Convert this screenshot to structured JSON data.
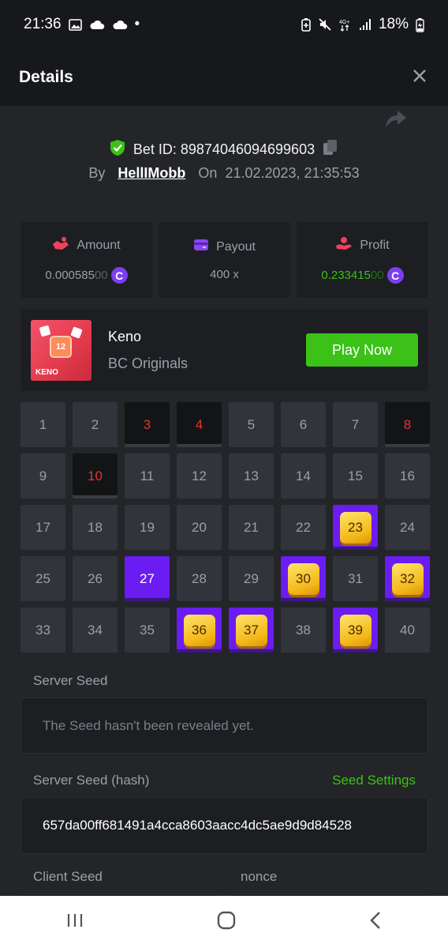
{
  "status_bar": {
    "time": "21:36",
    "dot": "•",
    "battery": "18%"
  },
  "header": {
    "title": "Details"
  },
  "bet": {
    "id_label": "Bet ID: 89874046094699603",
    "by_label": "By",
    "user": "HellIMobb",
    "on_label": "On",
    "datetime": "21.02.2023, 21:35:53"
  },
  "stats": {
    "amount": {
      "label": "Amount",
      "value_main": "0.000585",
      "value_dim": "00"
    },
    "payout": {
      "label": "Payout",
      "value": "400 x"
    },
    "profit": {
      "label": "Profit",
      "value_main": "0.233415",
      "value_dim": "00"
    }
  },
  "coin_symbol": "C",
  "game": {
    "name": "Keno",
    "provider": "BC Originals",
    "play_label": "Play Now",
    "thumb_number": "12",
    "thumb_label": "KENO"
  },
  "keno": {
    "numbers": [
      "1",
      "2",
      "3",
      "4",
      "5",
      "6",
      "7",
      "8",
      "9",
      "10",
      "11",
      "12",
      "13",
      "14",
      "15",
      "16",
      "17",
      "18",
      "19",
      "20",
      "21",
      "22",
      "23",
      "24",
      "25",
      "26",
      "27",
      "28",
      "29",
      "30",
      "31",
      "32",
      "33",
      "34",
      "35",
      "36",
      "37",
      "38",
      "39",
      "40"
    ],
    "states": [
      "n",
      "n",
      "miss",
      "miss",
      "n",
      "n",
      "n",
      "miss",
      "n",
      "miss",
      "n",
      "n",
      "n",
      "n",
      "n",
      "n",
      "n",
      "n",
      "n",
      "n",
      "n",
      "n",
      "hit",
      "n",
      "n",
      "n",
      "sel",
      "n",
      "n",
      "hit",
      "n",
      "hit",
      "n",
      "n",
      "n",
      "hit",
      "hit",
      "n",
      "hit",
      "n"
    ]
  },
  "seeds": {
    "server_seed_label": "Server Seed",
    "server_seed_value": "The Seed hasn't been revealed yet.",
    "server_hash_label": "Server Seed (hash)",
    "seed_settings_label": "Seed Settings",
    "server_hash_value": "657da00ff681491a4cca8603aacc4dc5ae9d9d84528",
    "client_seed_label": "Client Seed",
    "nonce_label": "nonce"
  },
  "colors": {
    "accent_green": "#3bc117",
    "accent_purple": "#6b1cf0",
    "miss_red": "#e1352f",
    "bg": "#232528"
  }
}
